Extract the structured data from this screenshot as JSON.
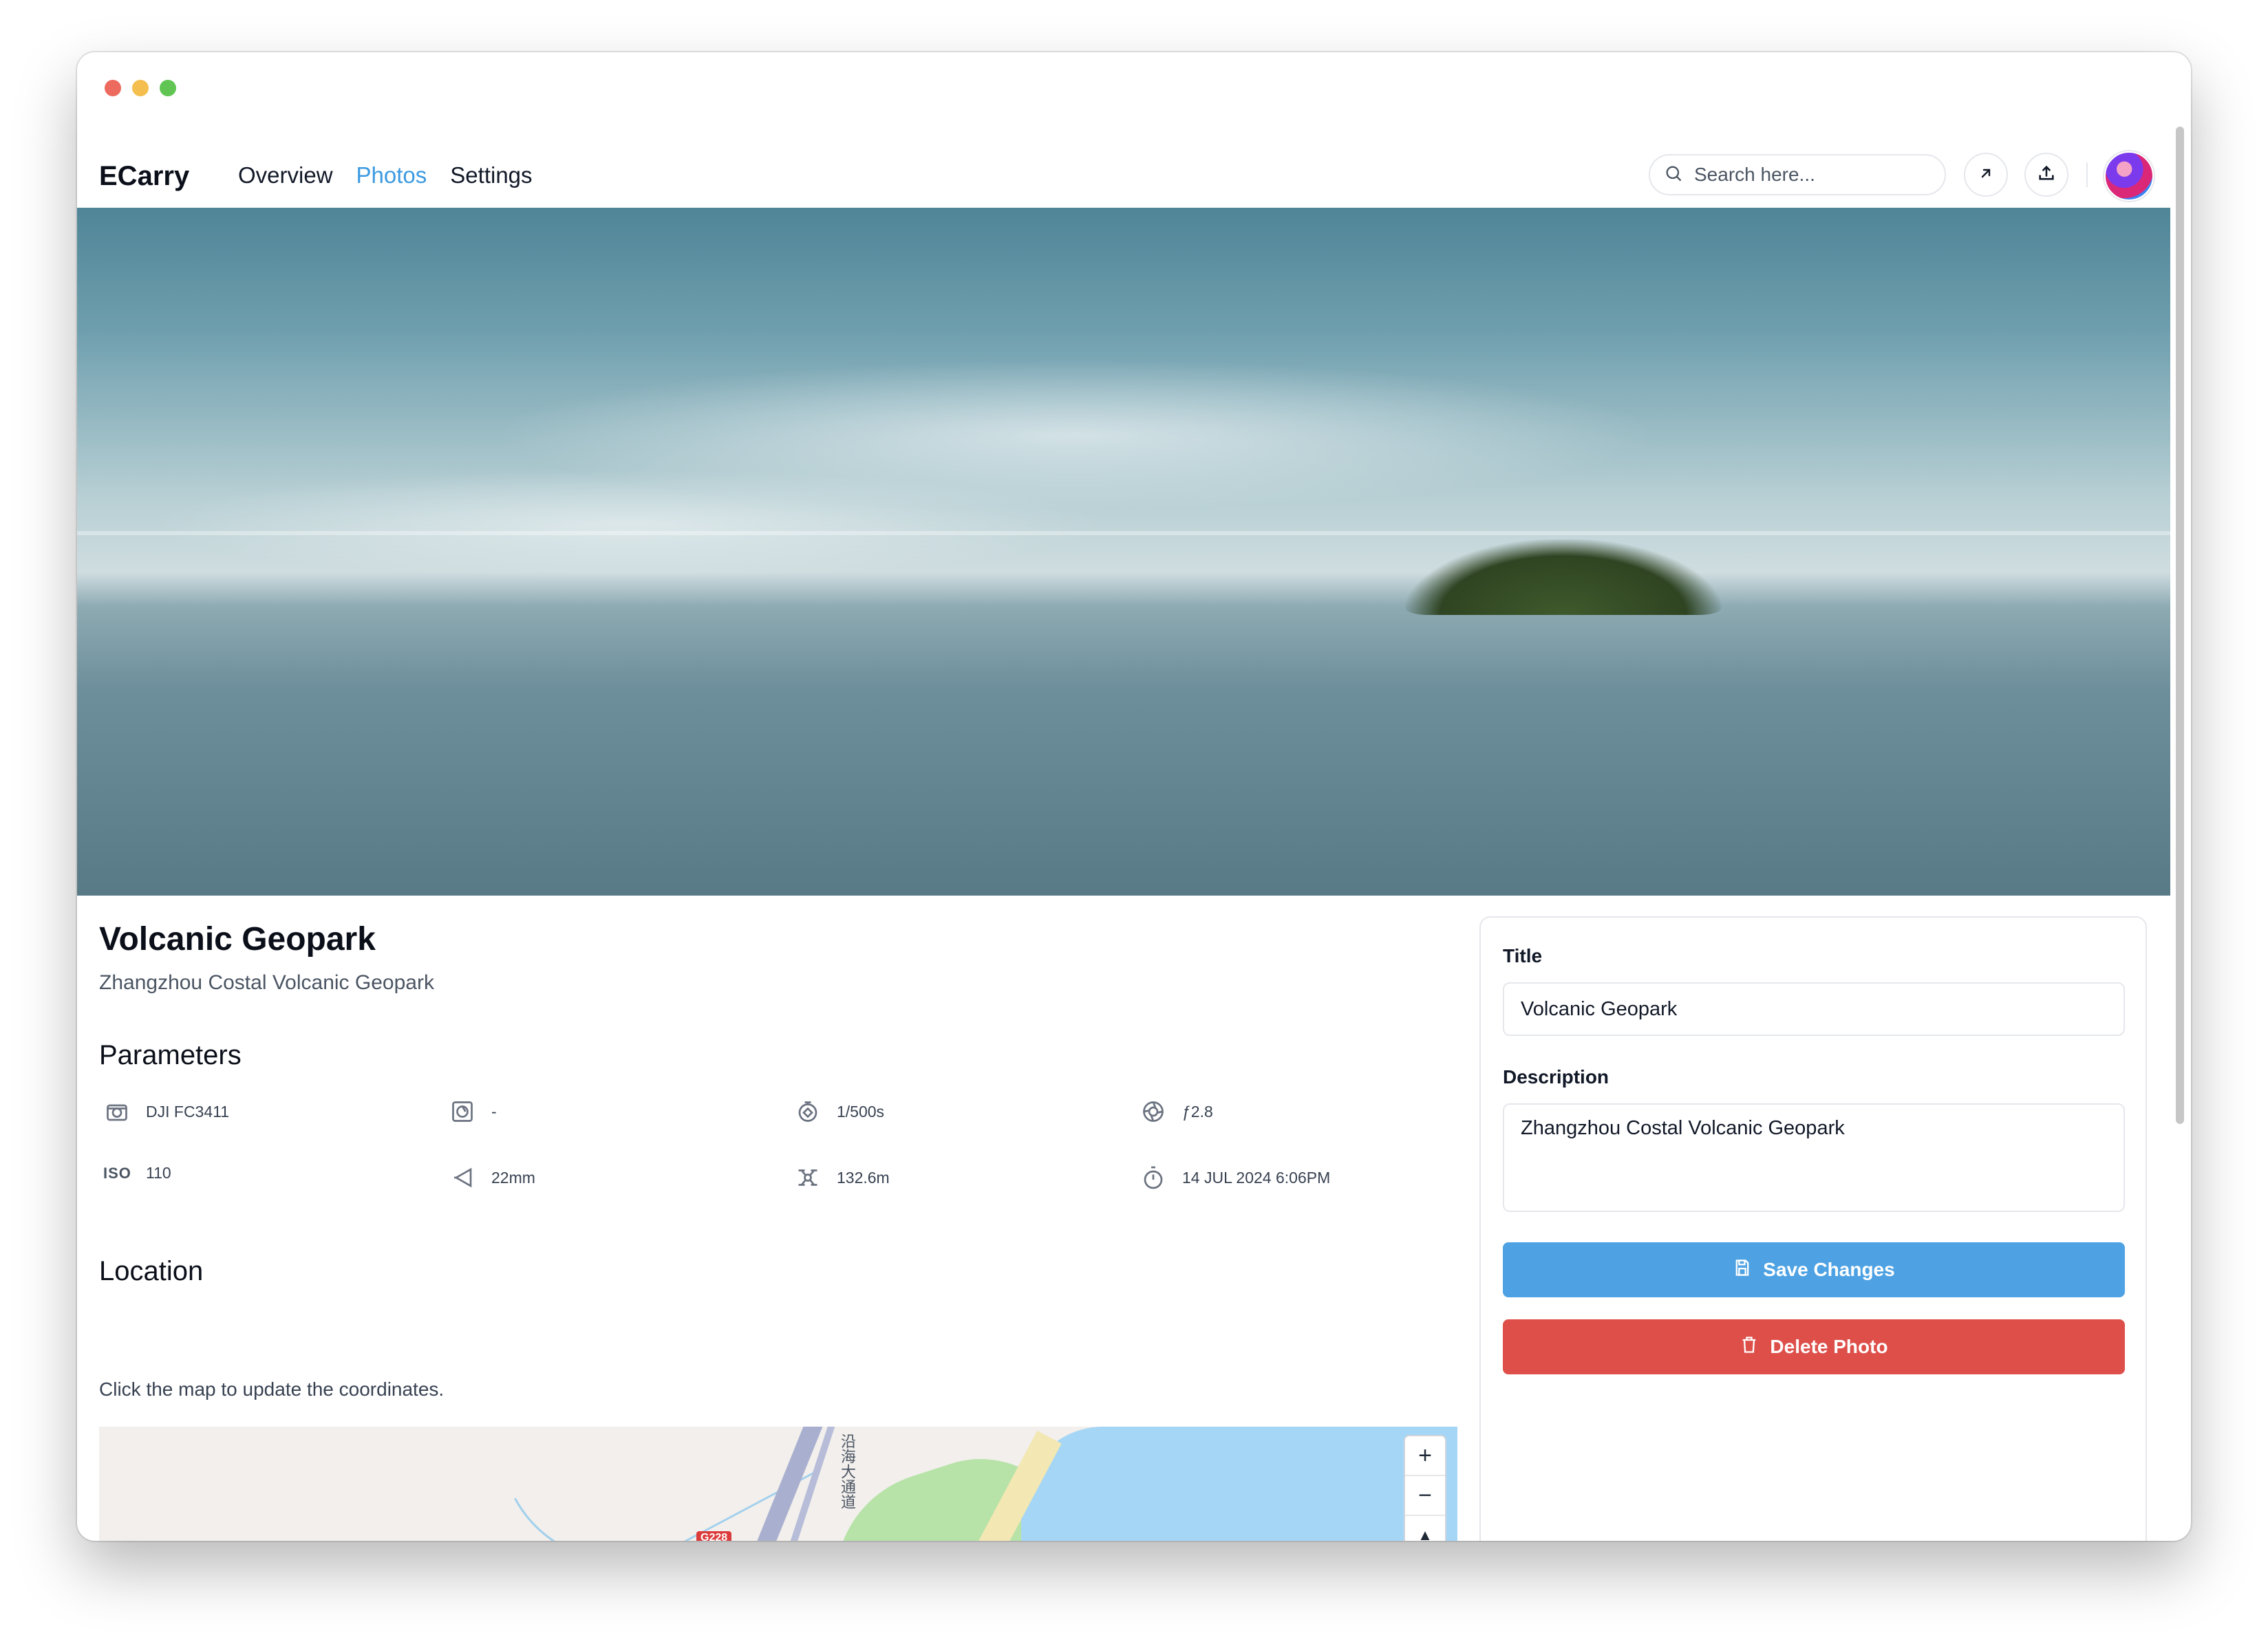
{
  "app": {
    "brand": "ECarry",
    "nav": [
      "Overview",
      "Photos",
      "Settings"
    ],
    "active_nav": "Photos"
  },
  "header": {
    "search_placeholder": "Search here...",
    "icons": [
      "search-icon",
      "arrow-up-right-icon",
      "upload-icon",
      "avatar"
    ]
  },
  "photo": {
    "title": "Volcanic Geopark",
    "subtitle": "Zhangzhou Costal Volcanic Geopark"
  },
  "parameters": {
    "heading": "Parameters",
    "items": [
      {
        "icon": "camera-icon",
        "value": "DJI FC3411"
      },
      {
        "icon": "lens-icon",
        "value": "-"
      },
      {
        "icon": "shutter-speed-icon",
        "value": "1/500s"
      },
      {
        "icon": "aperture-icon",
        "value": "ƒ2.8"
      },
      {
        "icon": "iso-label",
        "label": "ISO",
        "value": "110"
      },
      {
        "icon": "focal-length-icon",
        "value": "22mm"
      },
      {
        "icon": "altitude-icon",
        "value": "132.6m"
      },
      {
        "icon": "timer-icon",
        "value": "14 JUL 2024 6:06PM"
      }
    ]
  },
  "location": {
    "heading": "Location",
    "note": "Click the map to update the coordinates.",
    "map_road_label": "沿海大通道",
    "map_shield": "G228",
    "zoom_in": "+",
    "zoom_out": "−",
    "compass": "▲"
  },
  "form": {
    "title_label": "Title",
    "title_value": "Volcanic Geopark",
    "description_label": "Description",
    "description_value": "Zhangzhou Costal Volcanic Geopark",
    "save_label": "Save Changes",
    "delete_label": "Delete Photo"
  },
  "colors": {
    "accent": "#3b9ae1",
    "save": "#4ea2e3",
    "delete": "#de4f4a"
  }
}
